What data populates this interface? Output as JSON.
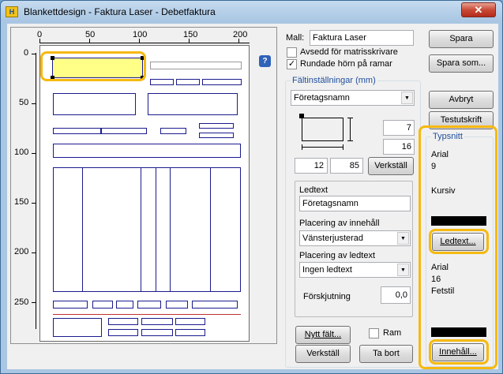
{
  "window": {
    "title": "Blankettdesign - Faktura Laser - Debetfaktura",
    "app_icon": "form-app-icon",
    "close_glyph": "✕"
  },
  "ruler": {
    "top_ticks": [
      "0",
      "50",
      "100",
      "150",
      "200"
    ],
    "left_ticks": [
      "0",
      "50",
      "100",
      "150",
      "200",
      "250"
    ]
  },
  "template": {
    "label": "Mall:",
    "value": "Faktura Laser",
    "help_glyph": "?"
  },
  "options": {
    "matrix_label": "Avsedd för matrisskrivare",
    "matrix_checked": false,
    "rounded_label": "Rundade hörn på ramar",
    "rounded_checked": true,
    "check_glyph": "✓"
  },
  "field_settings": {
    "title": "Fältinställningar (mm)",
    "field_select": "Företagsnamn",
    "width": "7",
    "height": "16",
    "x": "12",
    "y": "85",
    "apply_inline": "Verkställ",
    "leadtext_label": "Ledtext",
    "leadtext_value": "Företagsnamn",
    "content_placement_label": "Placering av innehåll",
    "content_placement_value": "Vänsterjusterad",
    "leadtext_placement_label": "Placering av ledtext",
    "leadtext_placement_value": "Ingen ledtext",
    "offset_label": "Förskjutning",
    "offset_value": "0,0",
    "new_field": "Nytt fält...",
    "frame_label": "Ram",
    "frame_checked": false,
    "apply": "Verkställ",
    "delete": "Ta bort"
  },
  "buttons": {
    "save": "Spara",
    "save_as": "Spara som...",
    "cancel": "Avbryt",
    "test_print": "Testutskrift"
  },
  "font_group": {
    "title": "Typsnitt",
    "lead_font": "Arial",
    "lead_size": "9",
    "lead_style": "Kursiv",
    "lead_color": "#000000",
    "lead_button": "Ledtext...",
    "content_font": "Arial",
    "content_size": "16",
    "content_style": "Fetstil",
    "content_color": "#000000",
    "content_button": "Innehåll..."
  },
  "colors": {
    "highlight": "#f6b90f",
    "selected_field": "#ffff88",
    "field_border": "#1b1b8e"
  }
}
